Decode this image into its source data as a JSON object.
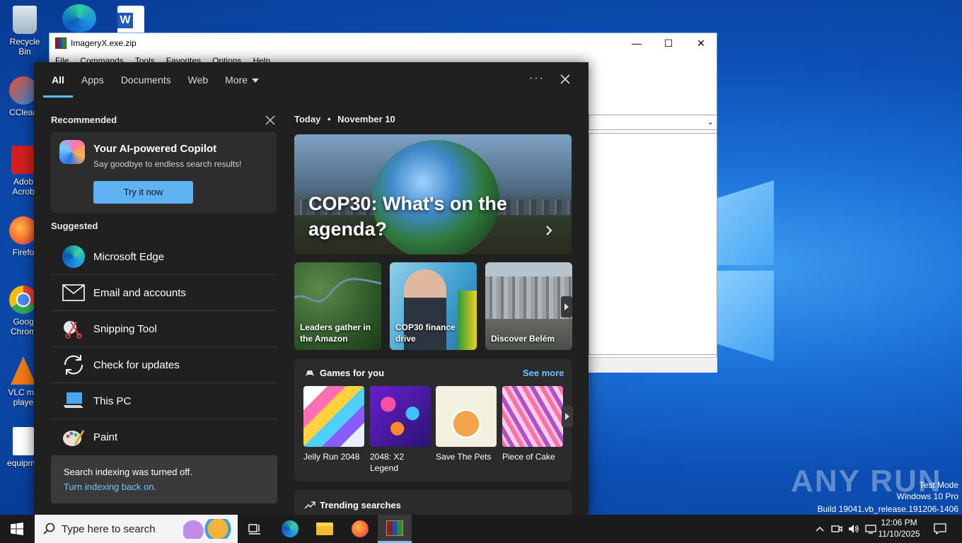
{
  "desktop": {
    "icons": [
      {
        "label": "Recycle Bin"
      },
      {
        "label": "CClean"
      },
      {
        "label": "Adob Acrob"
      },
      {
        "label": "Firefo"
      },
      {
        "label": "Goog Chrom"
      },
      {
        "label": "VLC me playe"
      },
      {
        "label": "equipme"
      }
    ],
    "watermark": "ANY RUN",
    "test_mode": [
      "Test Mode",
      "Windows 10 Pro",
      "Build 19041.vb_release.191206-1406"
    ]
  },
  "rar_window": {
    "title": "ImageryX.exe.zip",
    "menu": [
      "File",
      "Commands",
      "Tools",
      "Favorites",
      "Options",
      "Help"
    ],
    "minimize": "—",
    "maximize": "☐",
    "close": "✕"
  },
  "search_panel": {
    "tabs": [
      "All",
      "Apps",
      "Documents",
      "Web",
      "More"
    ],
    "active_tab": "All",
    "options_label": "···",
    "recommended_title": "Recommended",
    "copilot": {
      "title": "Your AI-powered Copilot",
      "subtitle": "Say goodbye to endless search results!",
      "button": "Try it now"
    },
    "suggested_title": "Suggested",
    "suggested": [
      {
        "label": "Microsoft Edge",
        "icon": "edge-icon"
      },
      {
        "label": "Email and accounts",
        "icon": "mail-icon"
      },
      {
        "label": "Snipping Tool",
        "icon": "snipping-tool-icon"
      },
      {
        "label": "Check for updates",
        "icon": "sync-icon"
      },
      {
        "label": "This PC",
        "icon": "computer-icon"
      },
      {
        "label": "Paint",
        "icon": "paint-icon"
      }
    ],
    "notice": {
      "text": "Search indexing was turned off.",
      "link": "Turn indexing back on."
    },
    "today": {
      "label": "Today",
      "date": "November 10"
    },
    "hero": {
      "headline": "COP30: What's on the agenda?"
    },
    "news": [
      {
        "caption": "Leaders gather in the Amazon"
      },
      {
        "caption": "COP30 finance drive"
      },
      {
        "caption": "Discover Belém"
      }
    ],
    "games": {
      "title": "Games for you",
      "see_more": "See more",
      "items": [
        {
          "label": "Jelly Run 2048"
        },
        {
          "label": "2048: X2 Legend"
        },
        {
          "label": "Save The Pets"
        },
        {
          "label": "Piece of Cake"
        }
      ]
    },
    "trending_title": "Trending searches"
  },
  "taskbar": {
    "search_placeholder": "Type here to search",
    "clock": {
      "time": "12:06 PM",
      "date": "11/10/2025"
    }
  },
  "colors": {
    "accent": "#4cc2ff",
    "panel_bg": "#202020",
    "link": "#6cc4ff"
  }
}
